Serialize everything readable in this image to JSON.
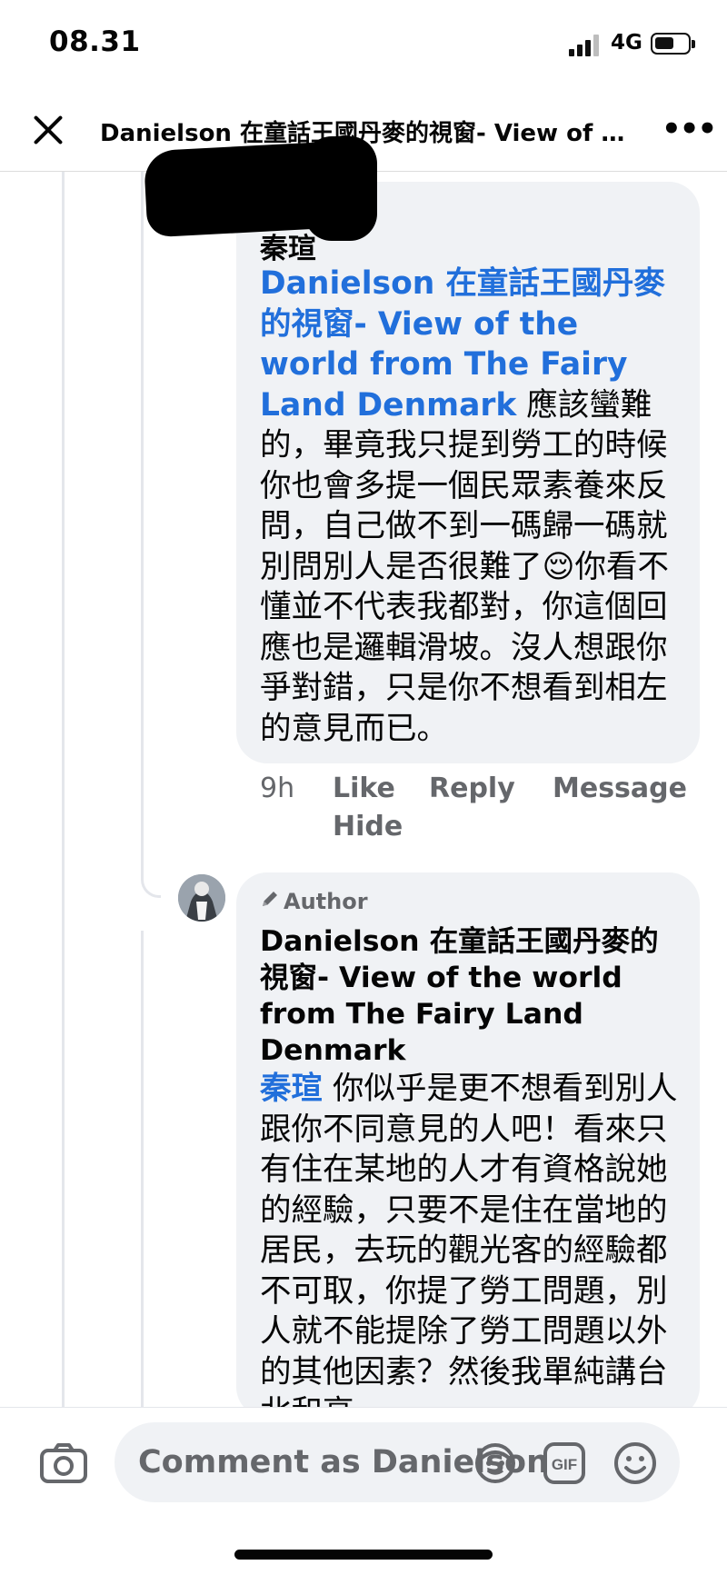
{
  "status_bar": {
    "time": "08.31",
    "network": "4G"
  },
  "header": {
    "title": "Danielson 在童話王國丹麥的視窗- View of the world from The Fairy Land Denmark",
    "close_icon": "close-icon",
    "more_icon": "more-dots-icon"
  },
  "comment1": {
    "author": "秦瑄",
    "mention": "Danielson 在童話王國丹麥的視窗- View of the world from The Fairy Land Denmark",
    "text": " 應該蠻難的，畢竟我只提到勞工的時候你也會多提一個民眾素養來反問，自己做不到一碼歸一碼就別問別人是否很難了😌你看不懂並不代表我都對，你這個回應也是邏輯滑坡。沒人想跟你爭對錯，只是你不想看到相左的意見而已。",
    "time": "9h",
    "actions": {
      "like": "Like",
      "reply": "Reply",
      "message": "Message",
      "hide": "Hide"
    }
  },
  "comment2": {
    "badge": "Author",
    "author": "Danielson 在童話王國丹麥的視窗- View of the world from The Fairy Land Denmark",
    "mention": "秦瑄",
    "text": " 你似乎是更不想看到別人跟你不同意見的人吧！看來只有住在某地的人才有資格說她的經驗，只要不是住在當地的居民，去玩的觀光客的經驗都不可取，你提了勞工問題，別人就不能提除了勞工問題以外的其他因素？然後我單純講台北和高"
  },
  "composer": {
    "placeholder": "Comment as Danielson",
    "icons": [
      "camera-icon",
      "avatar-sticker-icon",
      "gif-icon",
      "emoji-icon"
    ]
  }
}
